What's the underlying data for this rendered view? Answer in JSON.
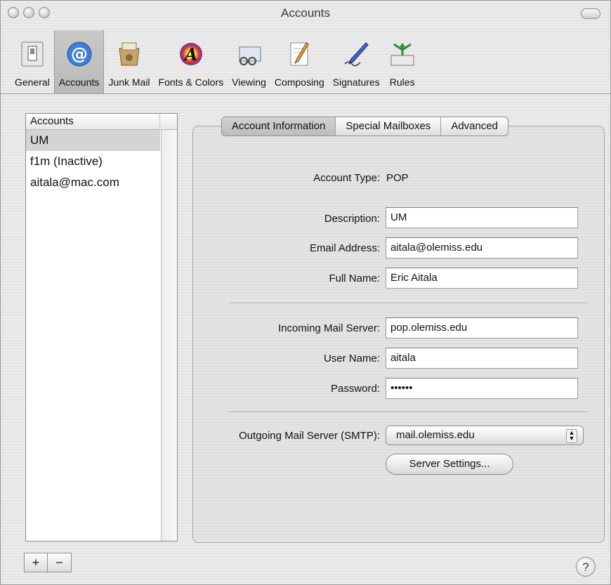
{
  "window": {
    "title": "Accounts"
  },
  "toolbar": {
    "items": [
      {
        "label": "General",
        "icon": "general-switch-icon"
      },
      {
        "label": "Accounts",
        "icon": "at-sign-icon",
        "selected": true
      },
      {
        "label": "Junk Mail",
        "icon": "junk-mail-icon"
      },
      {
        "label": "Fonts & Colors",
        "icon": "fonts-colors-icon"
      },
      {
        "label": "Viewing",
        "icon": "viewing-icon"
      },
      {
        "label": "Composing",
        "icon": "composing-icon"
      },
      {
        "label": "Signatures",
        "icon": "signature-pen-icon"
      },
      {
        "label": "Rules",
        "icon": "rules-icon"
      }
    ]
  },
  "accounts": {
    "header": "Accounts",
    "items": [
      "UM",
      "f1m (Inactive)",
      "aitala@mac.com"
    ],
    "add_label": "+",
    "remove_label": "−"
  },
  "tabs": [
    "Account Information",
    "Special Mailboxes",
    "Advanced"
  ],
  "form": {
    "account_type_label": "Account Type:",
    "account_type_value": "POP",
    "description_label": "Description:",
    "description_value": "UM",
    "email_label": "Email Address:",
    "email_value": "aitala@olemiss.edu",
    "fullname_label": "Full Name:",
    "fullname_value": "Eric Aitala",
    "incoming_label": "Incoming Mail Server:",
    "incoming_value": "pop.olemiss.edu",
    "username_label": "User Name:",
    "username_value": "aitala",
    "password_label": "Password:",
    "password_value": "••••••",
    "smtp_label": "Outgoing Mail Server (SMTP):",
    "smtp_value": "mail.olemiss.edu",
    "server_settings_label": "Server Settings..."
  },
  "help": {
    "label": "?"
  }
}
